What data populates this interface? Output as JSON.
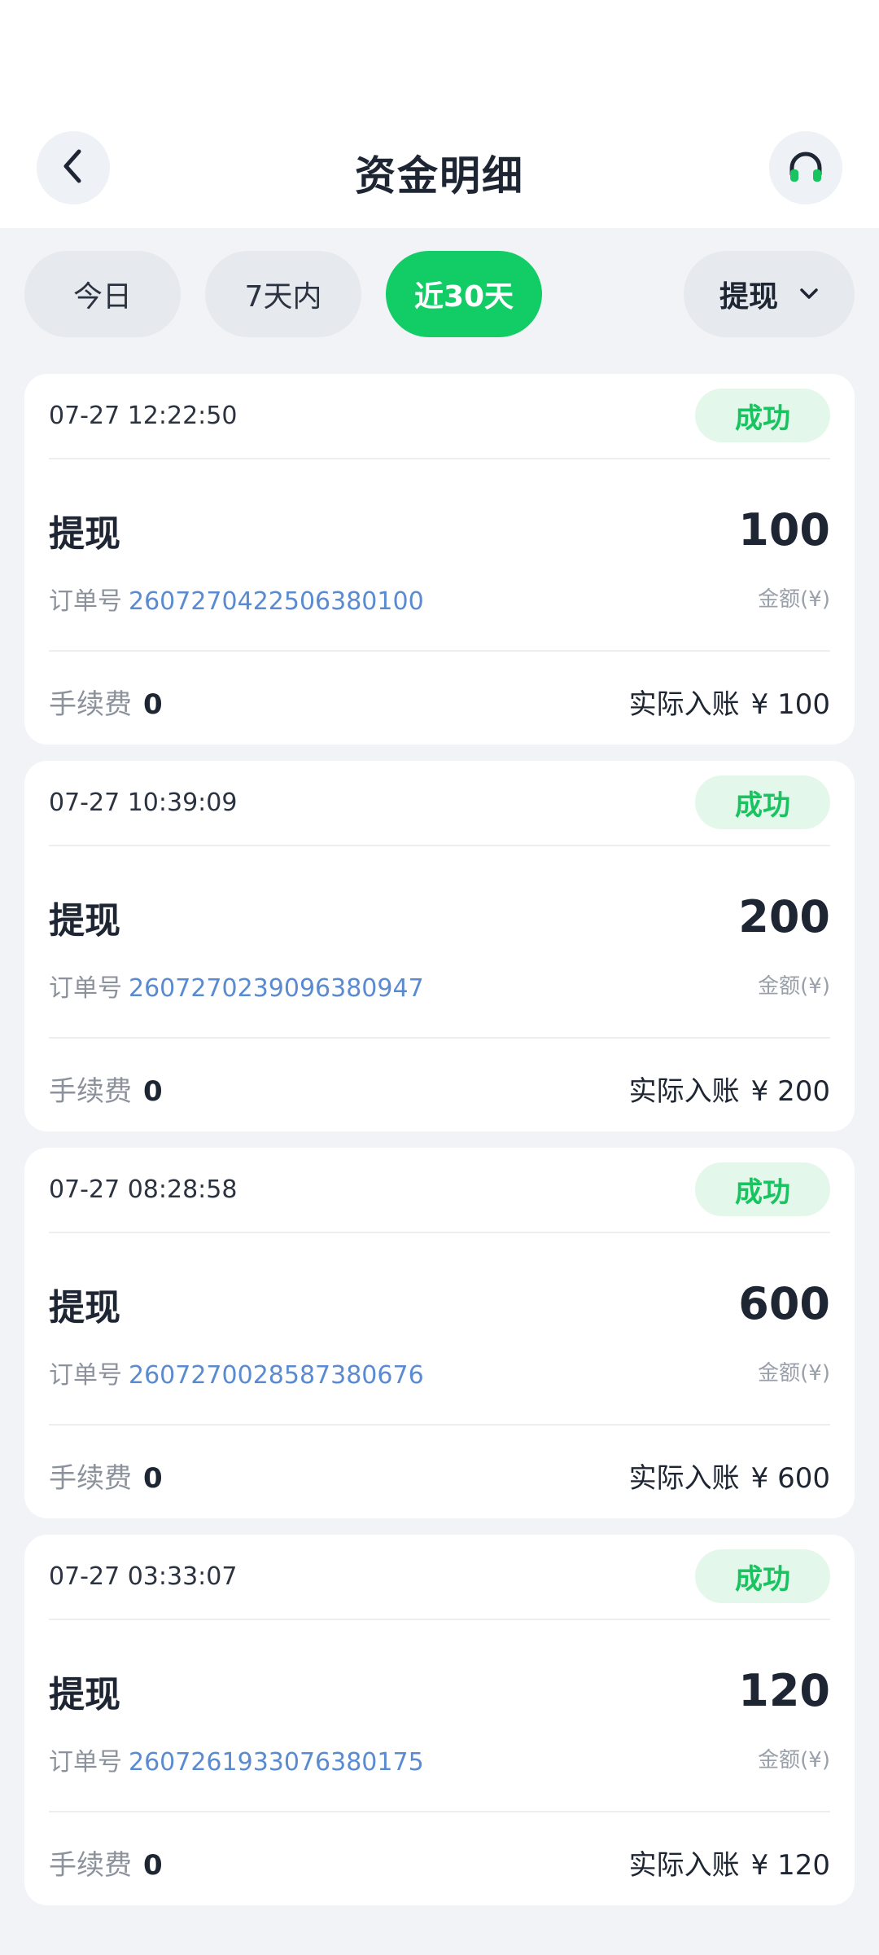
{
  "header": {
    "title": "资金明细",
    "back_icon": "chevron-left-icon",
    "support_icon": "headphones-icon"
  },
  "filters": {
    "chips": [
      "今日",
      "7天内",
      "近30天"
    ],
    "active": "近30天",
    "type_select": "提现"
  },
  "labels": {
    "order_prefix": "订单号",
    "amount_unit": "金额(¥)",
    "fee": "手续费",
    "actual": "实际入账",
    "currency": "¥"
  },
  "records": [
    {
      "time": "07-27 12:22:50",
      "status": "成功",
      "type": "提现",
      "amount": "100",
      "order_no": "2607270422506380100",
      "fee": "0",
      "actual": "100"
    },
    {
      "time": "07-27 10:39:09",
      "status": "成功",
      "type": "提现",
      "amount": "200",
      "order_no": "2607270239096380947",
      "fee": "0",
      "actual": "200"
    },
    {
      "time": "07-27 08:28:58",
      "status": "成功",
      "type": "提现",
      "amount": "600",
      "order_no": "2607270028587380676",
      "fee": "0",
      "actual": "600"
    },
    {
      "time": "07-27 03:33:07",
      "status": "成功",
      "type": "提现",
      "amount": "120",
      "order_no": "2607261933076380175",
      "fee": "0",
      "actual": "120"
    }
  ],
  "colors": {
    "accent": "#12cc66",
    "success_text": "#17c45f",
    "success_bg": "#e3f8ea",
    "order_link": "#5a8bd1"
  }
}
